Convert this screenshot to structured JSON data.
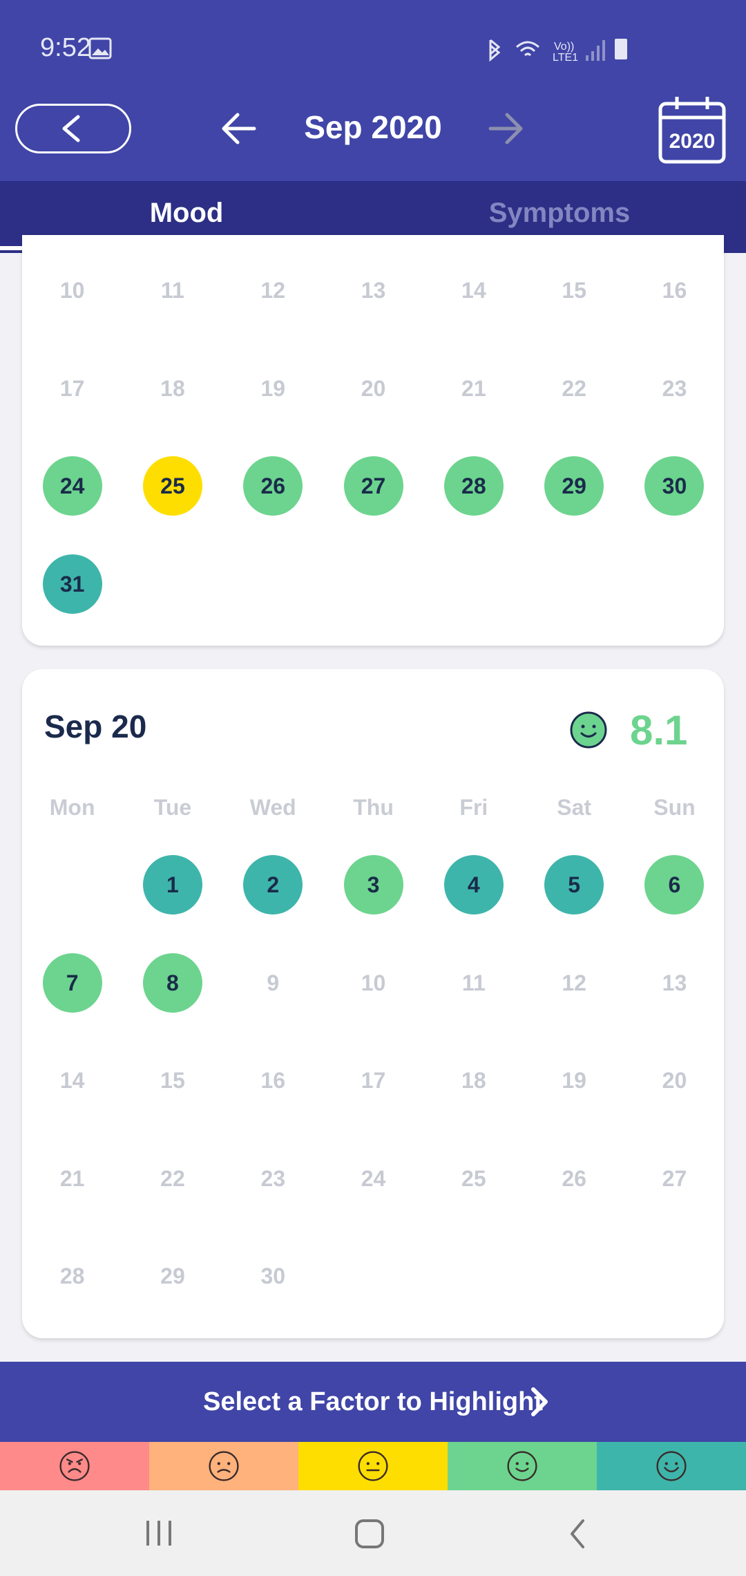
{
  "status_bar": {
    "time": "9:52"
  },
  "header": {
    "month_title": "Sep 2020",
    "year_button_label": "2020"
  },
  "tabs": [
    {
      "label": "Mood",
      "active": true
    },
    {
      "label": "Symptoms",
      "active": false
    }
  ],
  "aug_card": {
    "rows": [
      [
        "10",
        "11",
        "12",
        "13",
        "14",
        "15",
        "16"
      ],
      [
        "17",
        "18",
        "19",
        "20",
        "21",
        "22",
        "23"
      ],
      [
        "24",
        "25",
        "26",
        "27",
        "28",
        "29",
        "30"
      ],
      [
        "31"
      ]
    ],
    "moods": {
      "24": "green",
      "25": "yellow",
      "26": "green",
      "27": "green",
      "28": "green",
      "29": "green",
      "30": "green",
      "31": "teal"
    }
  },
  "sep_card": {
    "title": "Sep 20",
    "score": "8.1",
    "score_color": "#6cd48e",
    "weekdays": [
      "Mon",
      "Tue",
      "Wed",
      "Thu",
      "Fri",
      "Sat",
      "Sun"
    ],
    "rows": [
      [
        "",
        "1",
        "2",
        "3",
        "4",
        "5",
        "6"
      ],
      [
        "7",
        "8",
        "9",
        "10",
        "11",
        "12",
        "13"
      ],
      [
        "14",
        "15",
        "16",
        "17",
        "18",
        "19",
        "20"
      ],
      [
        "21",
        "22",
        "23",
        "24",
        "25",
        "26",
        "27"
      ],
      [
        "28",
        "29",
        "30"
      ]
    ],
    "moods": {
      "1": "teal",
      "2": "teal",
      "3": "green",
      "4": "teal",
      "5": "teal",
      "6": "green",
      "7": "green",
      "8": "green"
    }
  },
  "factor_bar": {
    "label": "Select a Factor to Highlight"
  },
  "legend": [
    {
      "name": "very-bad-face-icon",
      "color": "#ff8a8a"
    },
    {
      "name": "bad-face-icon",
      "color": "#ffb27c"
    },
    {
      "name": "neutral-face-icon",
      "color": "#fede00"
    },
    {
      "name": "good-face-icon",
      "color": "#6cd48e"
    },
    {
      "name": "very-good-face-icon",
      "color": "#3eb5ab"
    }
  ],
  "colors": {
    "header": "#4045a7",
    "tabs": "#2c2f85",
    "green": "#6cd48e",
    "teal": "#3eb5ab",
    "yellow": "#fede00"
  }
}
